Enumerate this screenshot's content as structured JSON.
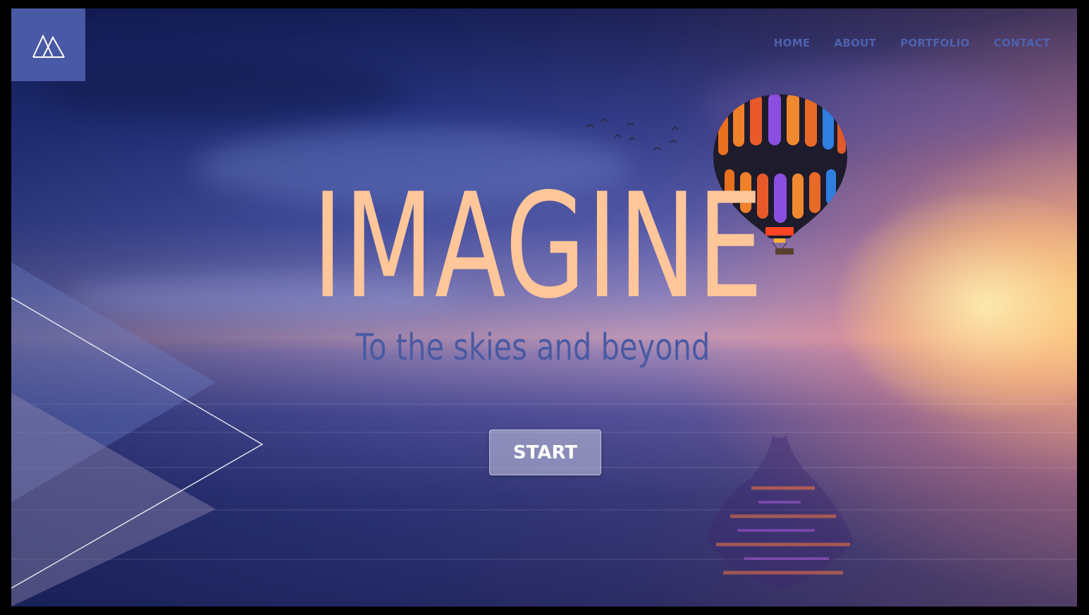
{
  "logo": {
    "icon": "mountain-logo-icon"
  },
  "nav": {
    "items": [
      {
        "label": "HOME"
      },
      {
        "label": "ABOUT"
      },
      {
        "label": "PORTFOLIO"
      },
      {
        "label": "CONTACT"
      }
    ]
  },
  "hero": {
    "title": "IMAGINE",
    "subtitle": "To the skies and beyond",
    "button_label": "START"
  },
  "colors": {
    "accent": "#4a59a5",
    "title": "#ffc69a",
    "subtitle": "#4a5aa3",
    "nav_text": "#4e61ad"
  },
  "scene": {
    "elements": [
      "hot-air-balloon",
      "birds",
      "sea",
      "sunset-glow",
      "geometric-triangles"
    ]
  }
}
